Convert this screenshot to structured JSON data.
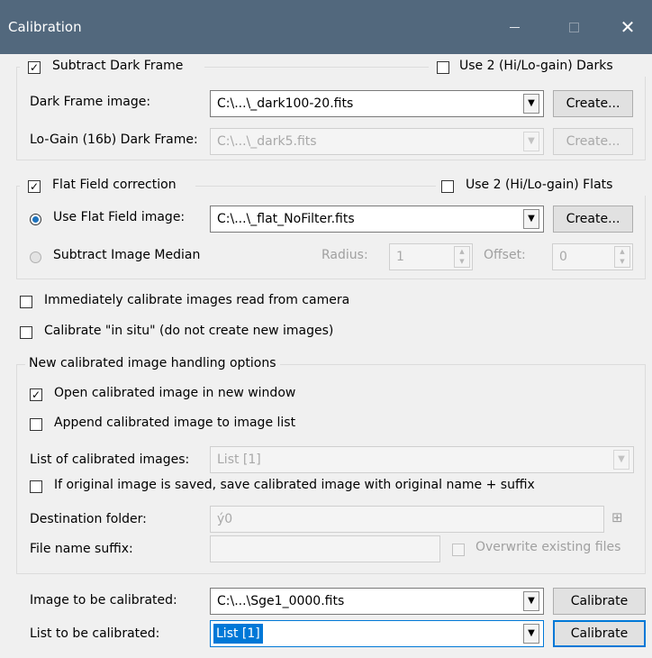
{
  "window": {
    "title": "Calibration"
  },
  "dark": {
    "subtract_label": "Subtract Dark Frame",
    "use2_label": "Use 2 (Hi/Lo-gain) Darks",
    "image_label": "Dark Frame image:",
    "image_value": "C:\\...\\_dark100-20.fits",
    "create_label": "Create...",
    "lo_label": "Lo-Gain (16b) Dark Frame:",
    "lo_value": "C:\\...\\_dark5.fits",
    "lo_create_label": "Create..."
  },
  "flat": {
    "correction_label": "Flat Field correction",
    "use2_label": "Use 2 (Hi/Lo-gain) Flats",
    "use_image_label": "Use Flat Field image:",
    "image_value": "C:\\...\\_flat_NoFilter.fits",
    "create_label": "Create...",
    "median_label": "Subtract Image Median",
    "radius_label": "Radius:",
    "radius_value": "1",
    "offset_label": "Offset:",
    "offset_value": "0"
  },
  "options": {
    "immediate_label": "Immediately calibrate images read from camera",
    "insitu_label": "Calibrate \"in situ\" (do not create new images)"
  },
  "handling": {
    "title": "New calibrated image handling options",
    "open_label": "Open calibrated image in new window",
    "append_label": "Append calibrated image to image list",
    "list_label": "List of calibrated images:",
    "list_value": "List [1]",
    "save_label": "If original image is saved, save calibrated image with original name + suffix",
    "dest_label": "Destination folder:",
    "dest_value": "ý0",
    "suffix_label": "File name suffix:",
    "suffix_value": "",
    "overwrite_label": "Overwrite existing files"
  },
  "bottom": {
    "image_label": "Image to be calibrated:",
    "image_value": "C:\\...\\Sge1_0000.fits",
    "calibrate1": "Calibrate",
    "list_label": "List to be calibrated:",
    "list_value": "List [1]",
    "calibrate2": "Calibrate"
  }
}
